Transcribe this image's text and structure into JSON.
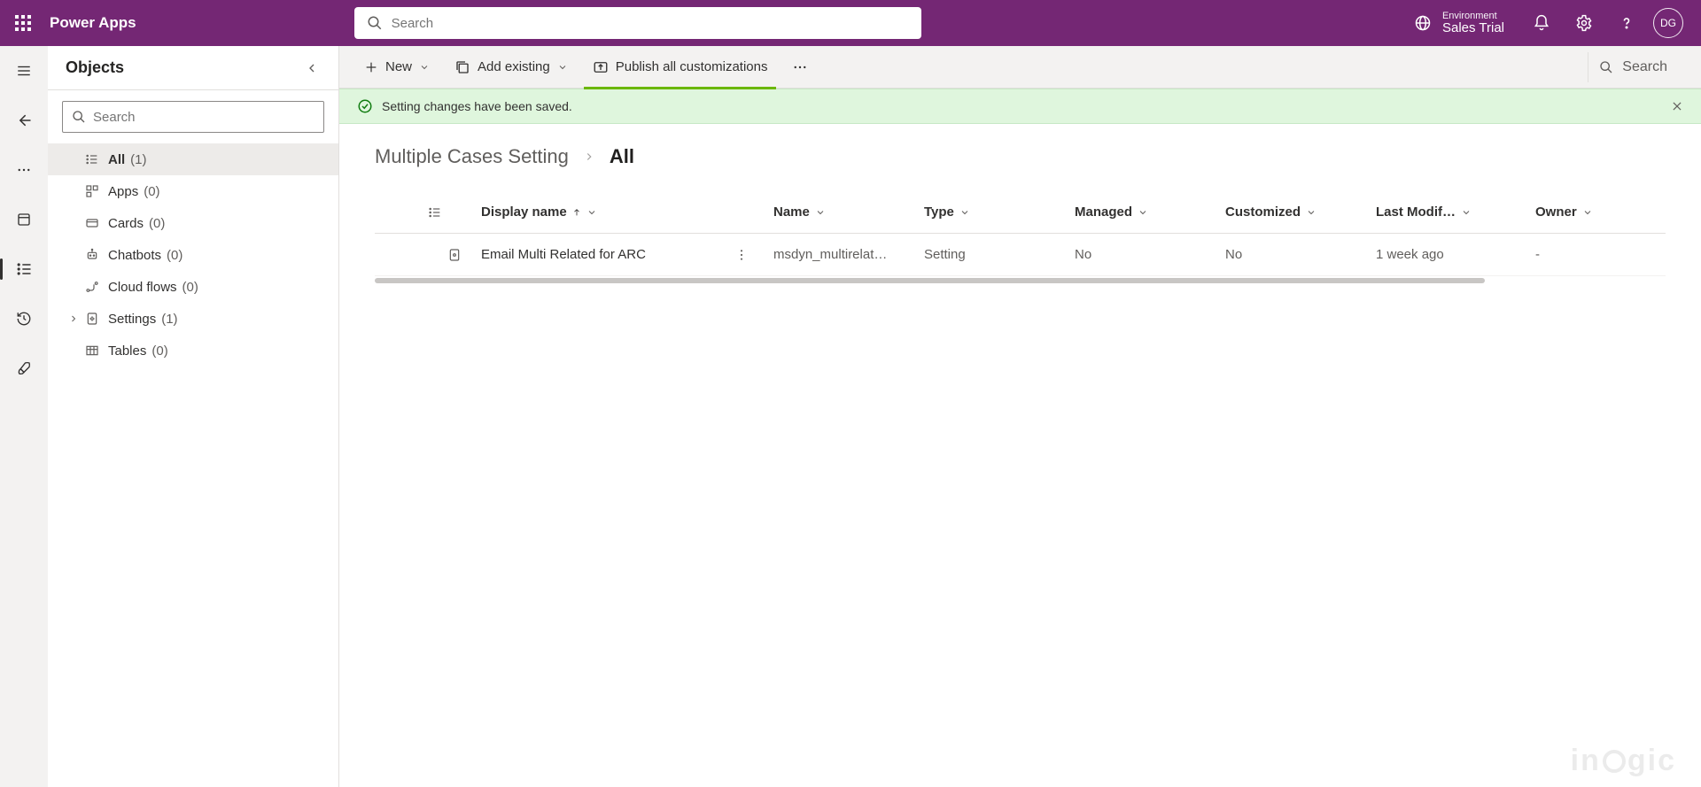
{
  "header": {
    "app_name": "Power Apps",
    "search_placeholder": "Search",
    "environment_label": "Environment",
    "environment_name": "Sales Trial",
    "avatar_initials": "DG"
  },
  "objects_panel": {
    "title": "Objects",
    "search_placeholder": "Search",
    "items": [
      {
        "label": "All",
        "count": "(1)",
        "icon": "list"
      },
      {
        "label": "Apps",
        "count": "(0)",
        "icon": "apps"
      },
      {
        "label": "Cards",
        "count": "(0)",
        "icon": "card"
      },
      {
        "label": "Chatbots",
        "count": "(0)",
        "icon": "bot"
      },
      {
        "label": "Cloud flows",
        "count": "(0)",
        "icon": "flow"
      },
      {
        "label": "Settings",
        "count": "(1)",
        "icon": "settings-doc",
        "expandable": true
      },
      {
        "label": "Tables",
        "count": "(0)",
        "icon": "table"
      }
    ]
  },
  "commandbar": {
    "new": "New",
    "add_existing": "Add existing",
    "publish": "Publish all customizations",
    "search_placeholder": "Search"
  },
  "banner": {
    "message": "Setting changes have been saved."
  },
  "breadcrumb": {
    "parent": "Multiple Cases Setting",
    "current": "All"
  },
  "table": {
    "columns": {
      "display_name": "Display name",
      "name": "Name",
      "type": "Type",
      "managed": "Managed",
      "customized": "Customized",
      "last_modified": "Last Modif…",
      "owner": "Owner"
    },
    "rows": [
      {
        "display_name": "Email Multi Related for ARC",
        "name": "msdyn_multirelat…",
        "type": "Setting",
        "managed": "No",
        "customized": "No",
        "last_modified": "1 week ago",
        "owner": "-"
      }
    ]
  },
  "watermark": "inogic"
}
